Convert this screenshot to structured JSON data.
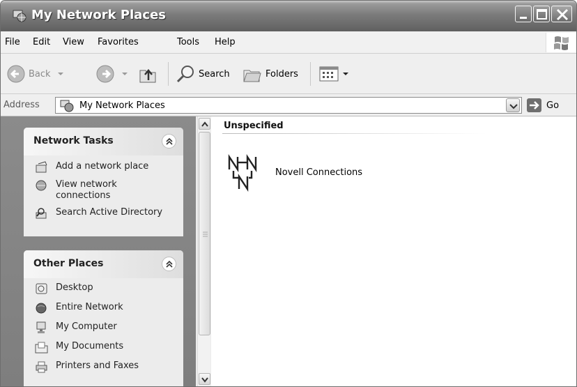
{
  "window": {
    "title": "My Network Places"
  },
  "menu": {
    "items": [
      "File",
      "Edit",
      "View",
      "Favorites",
      "Tools",
      "Help"
    ]
  },
  "toolbar": {
    "back_label": "Back",
    "search_label": "Search",
    "folders_label": "Folders"
  },
  "address": {
    "label": "Address",
    "value": "My Network Places",
    "go_label": "Go"
  },
  "network_tasks": {
    "title": "Network Tasks",
    "items": [
      {
        "label": "Add a network place",
        "icon": "add-network-place-icon"
      },
      {
        "label": "View network connections",
        "icon": "view-connections-icon"
      },
      {
        "label": "Search Active Directory",
        "icon": "search-directory-icon"
      }
    ]
  },
  "other_places": {
    "title": "Other Places",
    "items": [
      {
        "label": "Desktop",
        "icon": "desktop-icon"
      },
      {
        "label": "Entire Network",
        "icon": "globe-icon"
      },
      {
        "label": "My Computer",
        "icon": "computer-icon"
      },
      {
        "label": "My Documents",
        "icon": "documents-folder-icon"
      },
      {
        "label": "Printers and Faxes",
        "icon": "printer-icon"
      }
    ]
  },
  "content": {
    "group_title": "Unspecified",
    "items": [
      {
        "label": "Novell Connections",
        "icon": "novell-network-icon"
      }
    ]
  }
}
